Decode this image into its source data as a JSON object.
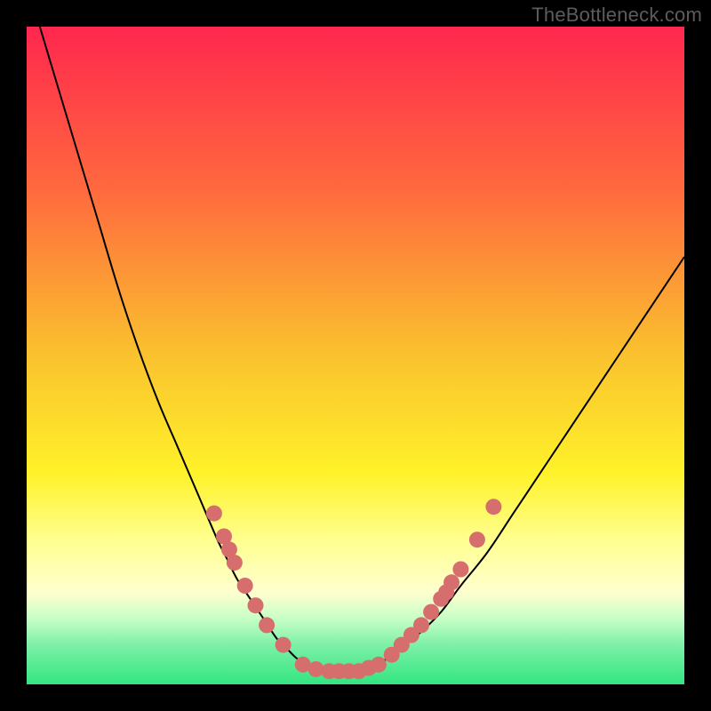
{
  "watermark": "TheBottleneck.com",
  "colors": {
    "bg_black": "#000000",
    "grad_top": "#ff274e",
    "grad_mid_upper": "#ff8b3a",
    "grad_mid": "#fadd2a",
    "grad_yellow_light": "#ffff8f",
    "grad_yellow_pale": "#ffffcf",
    "grad_green_pale": "#c7ffc7",
    "grad_green_mid": "#7df0a8",
    "grad_green": "#32e67f",
    "curve": "#000000",
    "dot": "#d76e6e"
  },
  "chart_data": {
    "type": "line",
    "title": "",
    "xlabel": "",
    "ylabel": "",
    "xlim": [
      0,
      100
    ],
    "ylim": [
      0,
      100
    ],
    "legend": false,
    "annotations": [
      "TheBottleneck.com"
    ],
    "series": [
      {
        "name": "bottleneck-curve",
        "x": [
          2,
          5,
          8,
          11,
          14,
          17,
          20,
          23,
          26,
          29,
          30.5,
          32,
          34,
          36,
          38,
          39.5,
          41,
          42.5,
          44,
          46,
          49,
          51,
          53,
          55,
          57,
          60,
          63,
          66,
          70,
          74,
          78,
          82,
          86,
          90,
          94,
          98,
          100
        ],
        "y": [
          100,
          90,
          80,
          70,
          60,
          51,
          43,
          36,
          29,
          22,
          19,
          16,
          13,
          10,
          7,
          5.5,
          4,
          3,
          2.3,
          2,
          2,
          2.3,
          3,
          4,
          5.5,
          8,
          11,
          15,
          20,
          26,
          32,
          38,
          44,
          50,
          56,
          62,
          65
        ]
      }
    ],
    "points": [
      {
        "name": "left-cluster",
        "coords": [
          {
            "x": 28.5,
            "y": 26
          },
          {
            "x": 30.0,
            "y": 22.5
          },
          {
            "x": 30.8,
            "y": 20.5
          },
          {
            "x": 31.6,
            "y": 18.5
          },
          {
            "x": 33.2,
            "y": 15.0
          },
          {
            "x": 34.8,
            "y": 12.0
          },
          {
            "x": 36.5,
            "y": 9.0
          },
          {
            "x": 39.0,
            "y": 6.0
          }
        ]
      },
      {
        "name": "bottom-cluster",
        "coords": [
          {
            "x": 42.0,
            "y": 3.0
          },
          {
            "x": 44.0,
            "y": 2.3
          },
          {
            "x": 46.0,
            "y": 2.0
          },
          {
            "x": 47.5,
            "y": 2.0
          },
          {
            "x": 49.0,
            "y": 2.0
          },
          {
            "x": 50.5,
            "y": 2.0
          },
          {
            "x": 52.0,
            "y": 2.5
          },
          {
            "x": 53.5,
            "y": 3.0
          }
        ]
      },
      {
        "name": "right-cluster",
        "coords": [
          {
            "x": 55.5,
            "y": 4.5
          },
          {
            "x": 57.0,
            "y": 6.0
          },
          {
            "x": 58.5,
            "y": 7.5
          },
          {
            "x": 60.0,
            "y": 9.0
          },
          {
            "x": 61.5,
            "y": 11.0
          },
          {
            "x": 63.0,
            "y": 13.0
          },
          {
            "x": 63.8,
            "y": 14.0
          },
          {
            "x": 64.6,
            "y": 15.5
          },
          {
            "x": 66.0,
            "y": 17.5
          },
          {
            "x": 68.5,
            "y": 22.0
          },
          {
            "x": 71.0,
            "y": 27.0
          }
        ]
      }
    ],
    "gradient_stops": [
      {
        "offset": 0.0,
        "color": "#ff274e"
      },
      {
        "offset": 0.25,
        "color": "#ff6a3e"
      },
      {
        "offset": 0.5,
        "color": "#fac22e"
      },
      {
        "offset": 0.68,
        "color": "#fff22a"
      },
      {
        "offset": 0.78,
        "color": "#ffff8f"
      },
      {
        "offset": 0.86,
        "color": "#ffffcf"
      },
      {
        "offset": 0.9,
        "color": "#c7ffc7"
      },
      {
        "offset": 0.94,
        "color": "#7df0a8"
      },
      {
        "offset": 1.0,
        "color": "#32e67f"
      }
    ]
  }
}
